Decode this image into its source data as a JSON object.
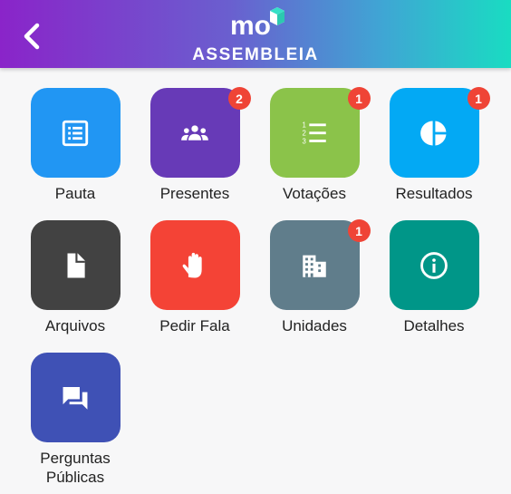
{
  "header": {
    "title": "ASSEMBLEIA",
    "logo_text": "mo",
    "gradient": [
      "#8a24c9",
      "#19dcc2"
    ]
  },
  "tiles": [
    {
      "label": "Pauta",
      "color": "#2196f3",
      "icon": "list-alt-icon",
      "badge": ""
    },
    {
      "label": "Presentes",
      "color": "#673ab7",
      "icon": "people-icon",
      "badge": "2"
    },
    {
      "label": "Votações",
      "color": "#8bc34a",
      "icon": "numbered-list-icon",
      "badge": "1"
    },
    {
      "label": "Resultados",
      "color": "#03a9f4",
      "icon": "pie-chart-icon",
      "badge": "1"
    },
    {
      "label": "Arquivos",
      "color": "#424242",
      "icon": "document-icon",
      "badge": ""
    },
    {
      "label": "Pedir Fala",
      "color": "#f44336",
      "icon": "hand-icon",
      "badge": ""
    },
    {
      "label": "Unidades",
      "color": "#607d8b",
      "icon": "building-icon",
      "badge": "1"
    },
    {
      "label": "Detalhes",
      "color": "#009688",
      "icon": "info-icon",
      "badge": ""
    },
    {
      "label": "Perguntas\nPúblicas",
      "color": "#3f51b5",
      "icon": "forum-icon",
      "badge": ""
    }
  ],
  "badge_color": "#ef4436"
}
